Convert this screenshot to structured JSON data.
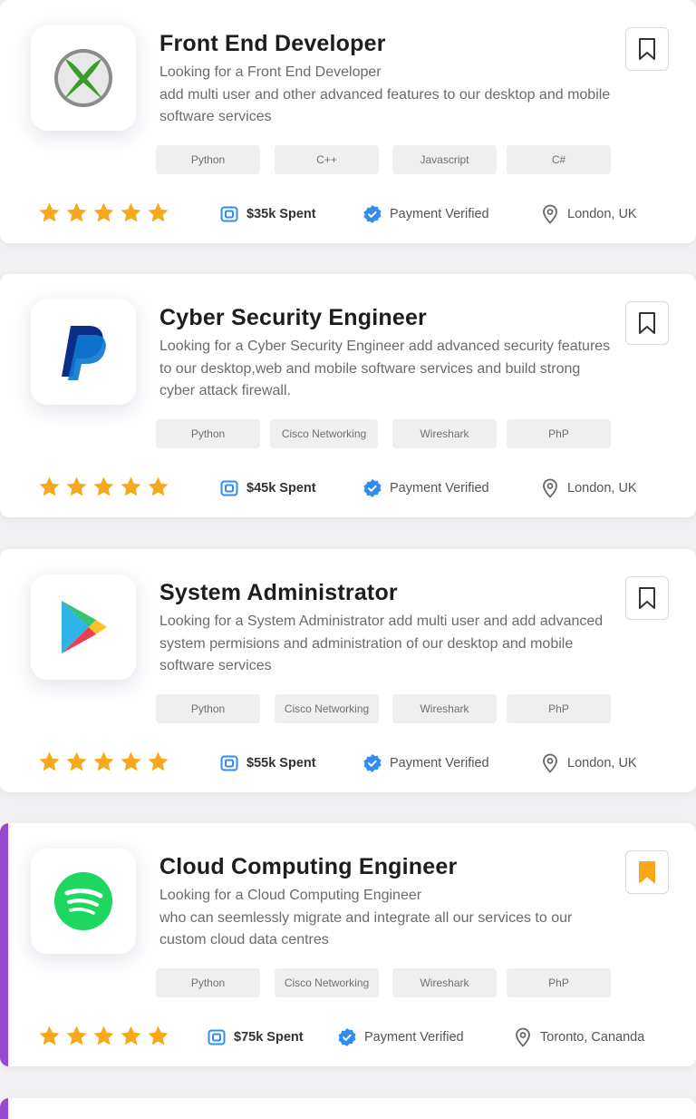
{
  "jobs": [
    {
      "title": "Front End Developer",
      "description": "Looking for a Front End Developer\n add multi user and other advanced features to our desktop and mobile software services",
      "logo_icon": "xbox-icon",
      "tags": [
        "Python",
        "C++",
        "Javascript",
        "C#"
      ],
      "rating": 5,
      "spent": "$35k Spent",
      "payment": "Payment Verified",
      "location": "London, UK",
      "bookmarked": false
    },
    {
      "title": "Cyber Security Engineer",
      "description": "Looking for a Cyber Security Engineer add advanced security features to our desktop,web and mobile software services and build strong cyber attack firewall.",
      "logo_icon": "paypal-icon",
      "tags": [
        "Python",
        "Cisco Networking",
        "Wireshark",
        "PhP"
      ],
      "rating": 5,
      "spent": "$45k Spent",
      "payment": "Payment Verified",
      "location": "London, UK",
      "bookmarked": false
    },
    {
      "title": "System Administrator",
      "description": "Looking for a System Administrator add multi user and add advanced system permisions and administration of our desktop and mobile software services",
      "logo_icon": "google-play-icon",
      "tags": [
        "Python",
        "Cisco Networking",
        "Wireshark",
        "PhP"
      ],
      "rating": 5,
      "spent": "$55k Spent",
      "payment": "Payment Verified",
      "location": "London, UK",
      "bookmarked": false
    },
    {
      "title": "Cloud Computing Engineer",
      "description": "Looking for a Cloud Computing Engineer\n who can seemlessly migrate and integrate all our services to our custom cloud data centres",
      "logo_icon": "spotify-icon",
      "tags": [
        "Python",
        "Cisco Networking",
        "Wireshark",
        "PhP"
      ],
      "rating": 5,
      "spent": "$75k Spent",
      "payment": "Payment Verified",
      "location": "Toronto, Cananda",
      "bookmarked": true
    }
  ],
  "colors": {
    "star": "#f7a81b",
    "verified": "#2f8cf0",
    "accent_bar": "#9a48d0",
    "bookmark_active": "#f9a61a"
  }
}
